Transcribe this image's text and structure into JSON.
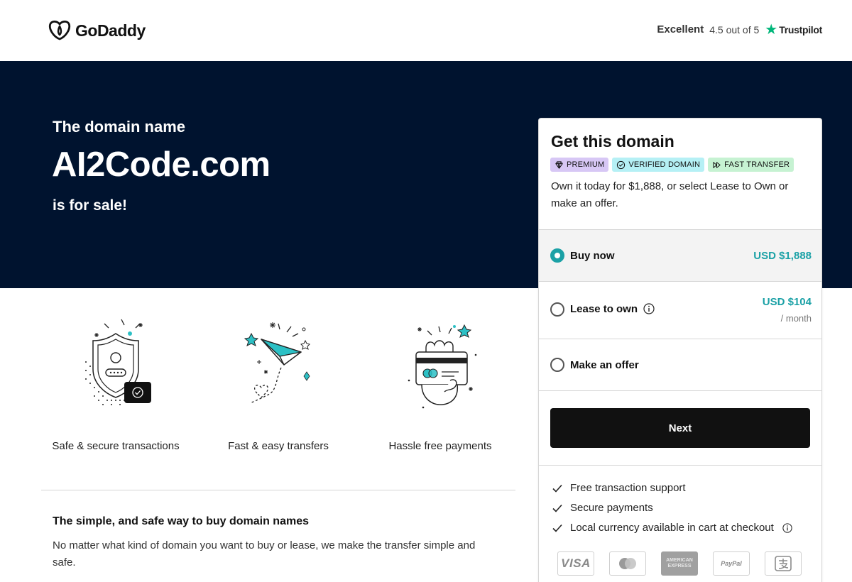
{
  "header": {
    "brand": "GoDaddy",
    "rating_label": "Excellent",
    "rating_score": "4.5 out of 5",
    "rating_provider": "Trustpilot"
  },
  "hero": {
    "pre": "The domain name",
    "domain": "AI2Code.com",
    "post": "is for sale!"
  },
  "features": [
    {
      "label": "Safe & secure transactions",
      "icon": "shield-check-icon"
    },
    {
      "label": "Fast & easy transfers",
      "icon": "paper-plane-icon"
    },
    {
      "label": "Hassle free payments",
      "icon": "hand-card-icon"
    }
  ],
  "info": {
    "title": "The simple, and safe way to buy domain names",
    "body": "No matter what kind of domain you want to buy or lease, we make the transfer simple and safe."
  },
  "card": {
    "title": "Get this domain",
    "badges": {
      "premium": "PREMIUM",
      "verified": "VERIFIED DOMAIN",
      "fast": "FAST TRANSFER"
    },
    "description": "Own it today for $1,888, or select Lease to Own or make an offer.",
    "options": {
      "buy": {
        "label": "Buy now",
        "price": "USD $1,888",
        "selected": true
      },
      "lease": {
        "label": "Lease to own",
        "price": "USD $104",
        "unit": "/ month"
      },
      "offer": {
        "label": "Make an offer"
      }
    },
    "next_label": "Next",
    "perks": [
      "Free transaction support",
      "Secure payments",
      "Local currency available in cart at checkout"
    ],
    "payment_methods": {
      "visa": "VISA",
      "amex": "AMERICAN EXPRESS",
      "paypal": "PayPal"
    }
  },
  "colors": {
    "hero_bg": "#00132f",
    "accent": "#1ba1a6",
    "button_bg": "#111111",
    "trustpilot": "#00b67a"
  }
}
